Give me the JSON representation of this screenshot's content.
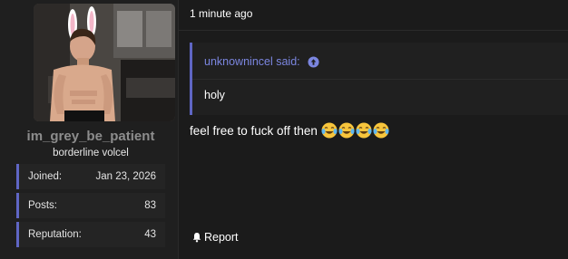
{
  "user": {
    "username": "im_grey_be_patient",
    "title": "borderline volcel",
    "stats": [
      {
        "label": "Joined:",
        "value": "Jan 23, 2026"
      },
      {
        "label": "Posts:",
        "value": "83"
      },
      {
        "label": "Reputation:",
        "value": "43"
      }
    ]
  },
  "post": {
    "time": "1 minute ago",
    "quote": {
      "author_text": "unknownincel said:",
      "body": "holy"
    },
    "message": "feel free to fuck off then",
    "emojis": [
      "face-with-tears-of-joy-icon",
      "face-with-tears-of-joy-icon",
      "face-with-tears-of-joy-icon",
      "face-with-tears-of-joy-icon"
    ],
    "report_label": "Report"
  },
  "colors": {
    "accent": "#5f66c4",
    "quote_link": "#7b86e0",
    "background": "#1b1b1b"
  }
}
